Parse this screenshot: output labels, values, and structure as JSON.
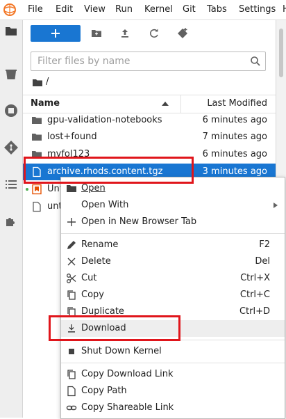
{
  "menubar": {
    "items": [
      "File",
      "Edit",
      "View",
      "Run",
      "Kernel",
      "Git",
      "Tabs",
      "Settings",
      "H"
    ]
  },
  "filebrowser": {
    "filter_placeholder": "Filter files by name",
    "breadcrumb": "/",
    "columns": {
      "name": "Name",
      "modified": "Last Modified"
    },
    "files": [
      {
        "name": "gpu-validation-notebooks",
        "modified": "6 minutes ago",
        "icon": "folder-icon"
      },
      {
        "name": "lost+found",
        "modified": "7 minutes ago",
        "icon": "folder-icon"
      },
      {
        "name": "myfol123",
        "modified": "6 minutes ago",
        "icon": "folder-icon"
      },
      {
        "name": "archive.rhods.content.tgz",
        "modified": "3 minutes ago",
        "icon": "file-icon",
        "selected": true
      },
      {
        "name": "Unt",
        "modified": "",
        "icon": "notebook-icon",
        "running": true
      },
      {
        "name": "unt",
        "modified": "",
        "icon": "file-icon"
      }
    ]
  },
  "context_menu": {
    "items": [
      {
        "label": "Open",
        "shortcut": "",
        "icon": "folder-icon"
      },
      {
        "label": "Open With",
        "shortcut": "",
        "icon": "",
        "submenu": true
      },
      {
        "label": "Open in New Browser Tab",
        "shortcut": "",
        "icon": "plus-icon"
      },
      {
        "label": "Rename",
        "shortcut": "F2",
        "icon": "pencil-icon"
      },
      {
        "label": "Delete",
        "shortcut": "Del",
        "icon": "close-icon"
      },
      {
        "label": "Cut",
        "shortcut": "Ctrl+X",
        "icon": "scissors-icon"
      },
      {
        "label": "Copy",
        "shortcut": "Ctrl+C",
        "icon": "copy-icon"
      },
      {
        "label": "Duplicate",
        "shortcut": "Ctrl+D",
        "icon": "copy-icon"
      },
      {
        "label": "Download",
        "shortcut": "",
        "icon": "download-icon",
        "hovered": true
      },
      {
        "label": "Shut Down Kernel",
        "shortcut": "",
        "icon": "stop-icon"
      },
      {
        "label": "Copy Download Link",
        "shortcut": "",
        "icon": "copy-icon"
      },
      {
        "label": "Copy Path",
        "shortcut": "",
        "icon": "file-icon"
      },
      {
        "label": "Copy Shareable Link",
        "shortcut": "",
        "icon": "link-icon"
      }
    ]
  },
  "colors": {
    "accent": "#1976d2",
    "highlight_box": "#e0151b",
    "running_dot": "#4caf50",
    "notebook_orange": "#e65100"
  }
}
